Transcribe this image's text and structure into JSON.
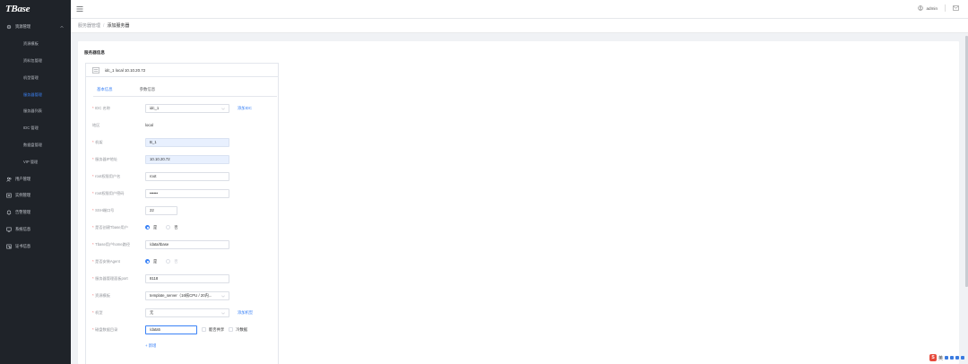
{
  "app": {
    "logo": "TBase"
  },
  "sidebar": {
    "groups": [
      {
        "label": "资源管理",
        "icon": "gear-icon",
        "expanded": true,
        "children": [
          {
            "label": "资源模板",
            "active": false
          },
          {
            "label": "资料包管理",
            "active": false
          },
          {
            "label": "机型管理",
            "active": false
          },
          {
            "label": "服务器管理",
            "active": true
          },
          {
            "label": "服务器列表",
            "active": false
          },
          {
            "label": "IDC 管理",
            "active": false
          },
          {
            "label": "数据盘管理",
            "active": false
          },
          {
            "label": "VIP 管理",
            "active": false
          }
        ]
      },
      {
        "label": "用户管理",
        "icon": "users-icon"
      },
      {
        "label": "实例管理",
        "icon": "instance-icon"
      },
      {
        "label": "告警管理",
        "icon": "bell-icon"
      },
      {
        "label": "系统信息",
        "icon": "monitor-icon"
      },
      {
        "label": "证书信息",
        "icon": "certificate-icon"
      }
    ]
  },
  "header": {
    "user": "admin"
  },
  "breadcrumb": {
    "parent": "服务器管理",
    "separator": "/",
    "current": "添加服务器"
  },
  "card": {
    "title": "服务器信息",
    "server_header": "idc_1 local 10.10.20.72",
    "tabs": [
      {
        "label": "基本信息",
        "active": true
      },
      {
        "label": "参数信息",
        "active": false
      }
    ],
    "form": {
      "idc": {
        "label": "IDC 名称",
        "value": "idc_1",
        "link": "添加IDC"
      },
      "region": {
        "label": "地区",
        "value": "local"
      },
      "machine": {
        "label": "机架",
        "value": "B_1"
      },
      "server_ip": {
        "label": "服务器IP地址",
        "value": "10.10.20.72"
      },
      "ssh_user": {
        "label": "root权限用户名",
        "value": "root"
      },
      "ssh_password": {
        "label": "root权限用户密码",
        "value": "••••••"
      },
      "ssh_port": {
        "label": "SSH端口号",
        "value": "22"
      },
      "create_tbase_user": {
        "label": "是否创建Tbase用户",
        "options": [
          "是",
          "否"
        ],
        "selected": "是"
      },
      "tbase_home": {
        "label": "Tbase用户home路径",
        "value": "/data/tbase"
      },
      "install_agent": {
        "label": "是否安装Agent",
        "options": [
          "是",
          "否"
        ],
        "selected": "是"
      },
      "agent_port": {
        "label": "服务器管理面板port",
        "value": "8118"
      },
      "resource_template": {
        "label": "资源模板",
        "value": "template_server（16核CPU / 20内..."
      },
      "machine_type": {
        "label": "机型",
        "value": "无",
        "link": "添加机型"
      },
      "data_dir": {
        "label": "磁盘数据目录",
        "value": "/data5",
        "checkboxes": [
          "能否共享",
          "冷数据"
        ]
      },
      "add_label": "+ 新增"
    }
  },
  "ime": {
    "logo": "S",
    "text": "英"
  },
  "colors": {
    "accent": "#3b82f6",
    "sidebar_bg": "#1f2329",
    "required": "#f56c6c"
  }
}
